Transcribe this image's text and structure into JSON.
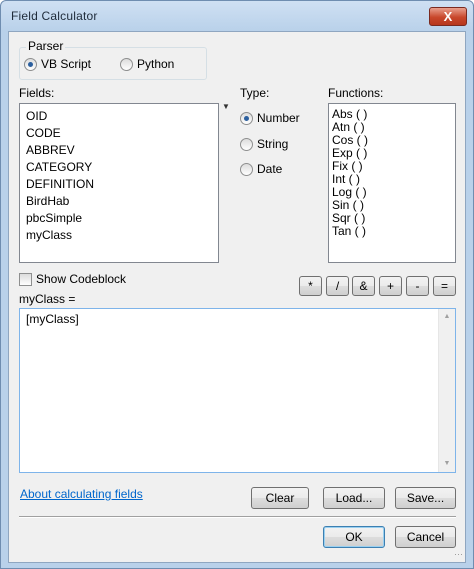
{
  "window": {
    "title": "Field Calculator",
    "close_label": "X"
  },
  "parser": {
    "label": "Parser",
    "options": [
      {
        "label": "VB Script",
        "selected": true
      },
      {
        "label": "Python",
        "selected": false
      }
    ]
  },
  "fields": {
    "label": "Fields:",
    "items": [
      "OID",
      "CODE",
      "ABBREV",
      "CATEGORY",
      "DEFINITION",
      "BirdHab",
      "pbcSimple",
      "myClass"
    ],
    "sort_icon": "sort-down-arrow-icon"
  },
  "type": {
    "label": "Type:",
    "options": [
      {
        "label": "Number",
        "selected": true
      },
      {
        "label": "String",
        "selected": false
      },
      {
        "label": "Date",
        "selected": false
      }
    ]
  },
  "functions": {
    "label": "Functions:",
    "items": [
      "Abs ( )",
      "Atn ( )",
      "Cos ( )",
      "Exp ( )",
      "Fix ( )",
      "Int ( )",
      "Log ( )",
      "Sin ( )",
      "Sqr ( )",
      "Tan ( )"
    ]
  },
  "show_codeblock": {
    "label": "Show Codeblock",
    "checked": false
  },
  "operators": [
    "*",
    "/",
    "&",
    "+",
    "-",
    "="
  ],
  "expression": {
    "label": "myClass =",
    "value": "[myClass]"
  },
  "link": {
    "label": "About calculating fields"
  },
  "buttons": {
    "clear": "Clear",
    "load": "Load...",
    "save": "Save...",
    "ok": "OK",
    "cancel": "Cancel"
  },
  "colors": {
    "link": "#0066cc",
    "close": "#c8472b",
    "frame": "#b9d1ea"
  }
}
